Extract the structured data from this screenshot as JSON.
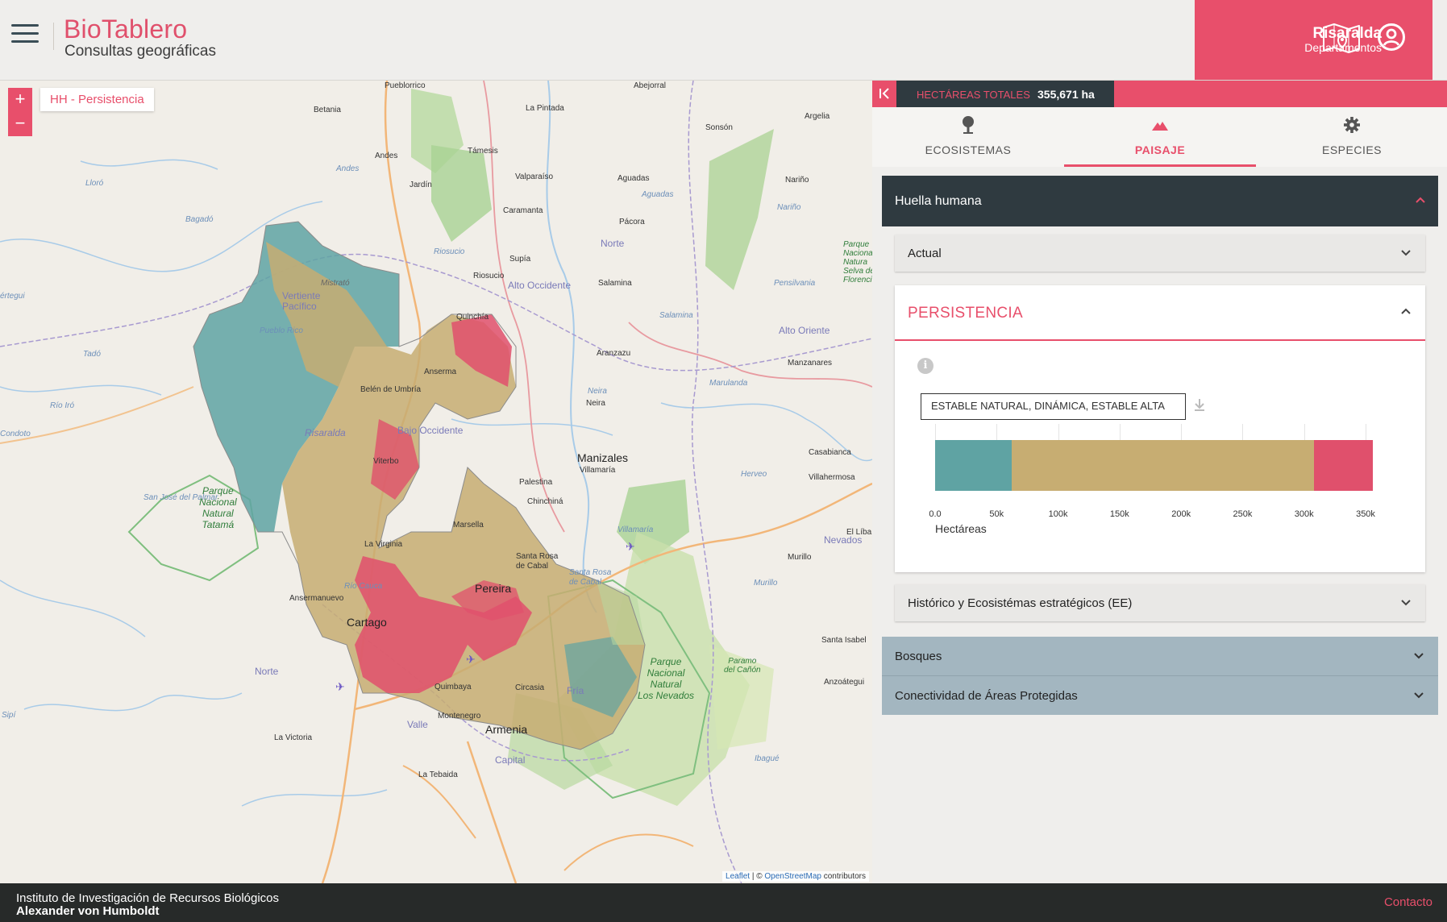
{
  "header": {
    "brand_title": "BioTablero",
    "brand_subtitle": "Consultas geográficas",
    "region_name": "Risaralda",
    "region_type": "Departamentos",
    "menu_icon": "hamburger-menu-icon",
    "map_icon": "map-icon",
    "user_icon": "user-account-icon"
  },
  "map": {
    "zoom_in": "+",
    "zoom_out": "−",
    "layer_tag": "HH - Persistencia",
    "places": {
      "pueblorrico": "Pueblorrico",
      "abejorral": "Abejorral",
      "betania": "Betania",
      "la_pintada": "La Pintada",
      "argelia": "Argelia",
      "sonson": "Sonsón",
      "andes": "Andes",
      "tamesis": "Támesis",
      "valparaiso": "Valparaíso",
      "aguadas": "Aguadas",
      "narino": "Nariño",
      "jardin": "Jardín",
      "caramanta": "Caramanta",
      "pacora": "Pácora",
      "supia": "Supía",
      "salamina": "Salamina",
      "riosucio": "Riosucio",
      "quinchia": "Quinchía",
      "mistrato": "Mistrató",
      "anserma": "Anserma",
      "aranzazu": "Aranzazu",
      "manzanares": "Manzanares",
      "neira": "Neira",
      "belen_de_umbria": "Belén de Umbría",
      "risaralda": "Risaralda",
      "viterbo": "Viterbo",
      "manizales": "Manizales",
      "villamaria": "Villamaría",
      "palestina": "Palestina",
      "chinchina": "Chinchiná",
      "marsella": "Marsella",
      "la_virginia": "La Virginia",
      "santa_rosa": "Santa Rosa de Cabal",
      "pereira": "Pereira",
      "ansermanuevo": "Ansermanuevo",
      "cartago": "Cartago",
      "quimbaya": "Quimbaya",
      "circasia": "Circasia",
      "montenegro": "Montenegro",
      "armenia": "Armenia",
      "la_victoria": "La Victoria",
      "la_tebaida": "La Tebaida",
      "casabianca": "Casabianca",
      "villahermosa": "Villahermosa",
      "murillo": "Murillo",
      "santa_isabel": "Santa Isabel",
      "anzoategui": "Anzoátegui",
      "el_libano": "El Líba",
      "condoto": "Condoto",
      "tado": "Tadó",
      "pueblo_rico": "Pueblo Rico",
      "san_jose": "San José del Palmar"
    },
    "regions": {
      "norte1": "Norte",
      "alto_occidente": "Alto Occidente",
      "alto_oriente": "Alto Oriente",
      "bajo_occidente": "Bajo Occidente",
      "vertiente_pacifico": "Vertiente Pacífico",
      "norte2": "Norte",
      "valle": "Valle",
      "capital": "Capital",
      "fria": "Fría",
      "nevados": "Nevados"
    },
    "waters": {
      "lloro": "Lloró",
      "bagado": "Bagadó",
      "andes_r": "Andes",
      "riosucio_r": "Riosucio",
      "aguadas_r": "Aguadas",
      "narino_r": "Nariño",
      "pensilvania": "Pensilvania",
      "salamina_r": "Salamina",
      "marulanda": "Marulanda",
      "neira_r": "Neira",
      "herveo": "Herveo",
      "villamaria_r": "Villamaría",
      "rio_iro": "Río Iró",
      "rio_cauca": "Río Cauca",
      "santa_rosa_r": "Santa Rosa de Cabal",
      "murillo_r": "Murillo",
      "ibague": "Ibagué",
      "sipi": "Sipí",
      "ertegui": "értegui"
    },
    "parks": {
      "tatama": [
        "Parque",
        "Nacional",
        "Natural",
        "Tatamá"
      ],
      "nevados": [
        "Parque",
        "Nacional",
        "Natural",
        "Los Nevados"
      ],
      "selva": [
        "Parque",
        "Naciona",
        "Natura",
        "Selva de",
        "Florenci"
      ],
      "paramo": [
        "Paramo",
        "del Cañón"
      ]
    },
    "attribution_leaflet": "Leaflet",
    "attribution_sep": " | © ",
    "attribution_osm": "OpenStreetMap",
    "attribution_tail": " contributors"
  },
  "panel": {
    "collapse_icon": "collapse-panel-icon",
    "totals_label": "HECTÁREAS TOTALES",
    "totals_value": "355,671 ha",
    "tabs": [
      {
        "label": "ECOSISTEMAS",
        "icon": "pin-icon"
      },
      {
        "label": "PAISAJE",
        "icon": "mountain-icon"
      },
      {
        "label": "ESPECIES",
        "icon": "gear-icon"
      }
    ],
    "huella_humana": "Huella humana",
    "actual": "Actual",
    "persistencia": "PERSISTENCIA",
    "info_icon": "i",
    "legend_text": "ESTABLE NATURAL, DINÁMICA, ESTABLE ALTA",
    "download_icon": "download-icon",
    "historico": "Histórico y Ecosistémas estratégicos (EE)",
    "bosques": "Bosques",
    "conectividad": "Conectividad de Áreas Protegidas"
  },
  "chart_data": {
    "type": "bar",
    "orientation": "horizontal-stacked",
    "categories": [
      "Persistencia"
    ],
    "series": [
      {
        "name": "ESTABLE NATURAL",
        "values": [
          62000
        ],
        "color": "#5fa3a3"
      },
      {
        "name": "DINÁMICA",
        "values": [
          246000
        ],
        "color": "#c7ad72"
      },
      {
        "name": "ESTABLE ALTA",
        "values": [
          47671
        ],
        "color": "#e0506c"
      }
    ],
    "xlabel": "Hectáreas",
    "xlim": [
      0,
      355671
    ],
    "xticks": [
      "0.0",
      "50k",
      "100k",
      "150k",
      "200k",
      "250k",
      "300k",
      "350k"
    ],
    "xtick_values": [
      0,
      50000,
      100000,
      150000,
      200000,
      250000,
      300000,
      350000
    ],
    "grid": true
  },
  "footer": {
    "line1": "Instituto de Investigación de Recursos Biológicos",
    "line2": "Alexander von Humboldt",
    "contact": "Contacto"
  },
  "colors": {
    "accent": "#e84f6b",
    "dark": "#2f3a40",
    "section": "#a3b6c0"
  }
}
